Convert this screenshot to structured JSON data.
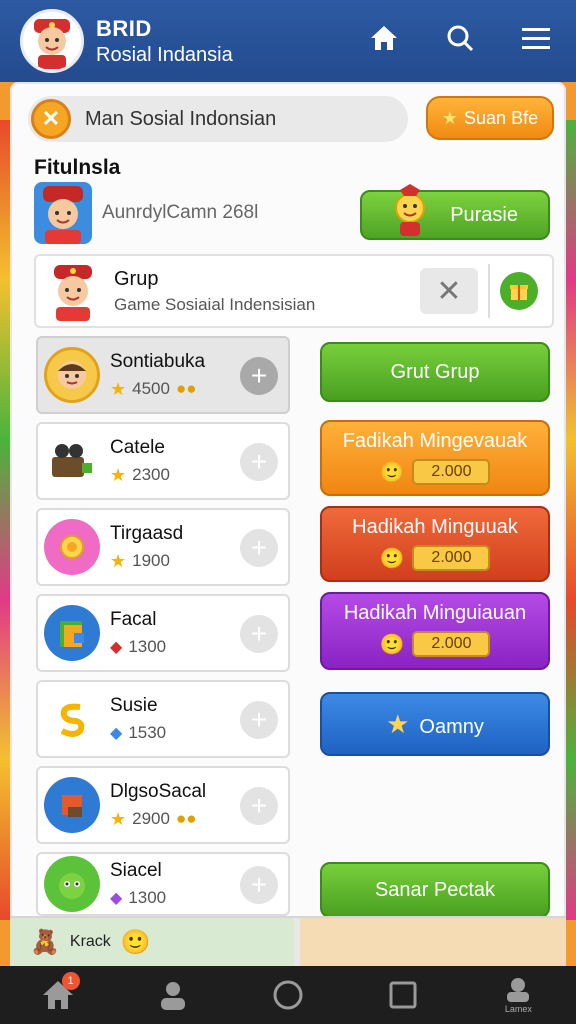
{
  "header": {
    "title": "BRID",
    "subtitle": "Rosial Indansia"
  },
  "icons": {
    "home": "home-icon",
    "search": "search-icon",
    "menu": "menu-icon"
  },
  "search": {
    "value": "Man Sosial Indonsian"
  },
  "suan_button": {
    "label": "Suan Bfe"
  },
  "section_title": "Fitulnsla",
  "feature": {
    "text": "AunrdylCamn 268l",
    "button_label": "Purasie"
  },
  "group": {
    "title": "Grup",
    "subtitle": "Game Sosiaial Indensisian"
  },
  "games": [
    {
      "name": "Sontiabuka",
      "score": "4500"
    },
    {
      "name": "Catele",
      "score": "2300"
    },
    {
      "name": "Tirgaasd",
      "score": "1900"
    },
    {
      "name": "Facal",
      "score": "1300"
    },
    {
      "name": "Susie",
      "score": "1530"
    },
    {
      "name": "DlgsoSacal",
      "score": "2900"
    },
    {
      "name": "Siacel",
      "score": "1300"
    }
  ],
  "actions": {
    "grut_grup": "Grut Grup",
    "offer1": {
      "label": "Fadikah Mingevauak",
      "price": "2.000"
    },
    "offer2": {
      "label": "Hadikah Minguuak",
      "price": "2.000"
    },
    "offer3": {
      "label": "Hadikah Minguiauan",
      "price": "2.000"
    },
    "oamny": "Oamny",
    "sanar": "Sanar Pectak"
  },
  "bottom": {
    "label": "Krack"
  },
  "navbar": {
    "badge": "1",
    "last_label": "Lamex"
  },
  "colors": {
    "header": "#2d5aa3",
    "background": "#f29a2e",
    "green": "#4ea424",
    "orange": "#f08612",
    "red": "#d23e1e",
    "purple": "#8a23c4",
    "blue": "#1f62c2"
  }
}
